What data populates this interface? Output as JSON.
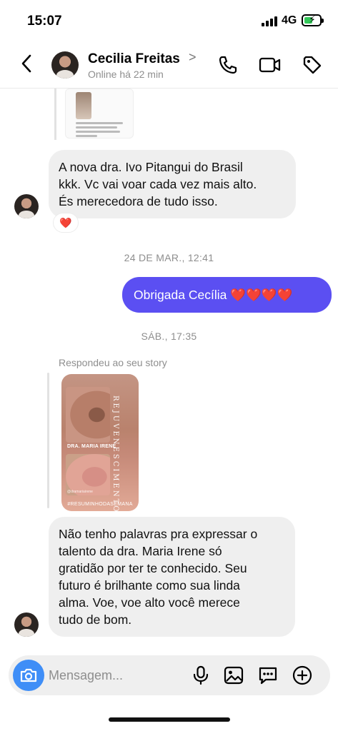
{
  "status_bar": {
    "time": "15:07",
    "network": "4G"
  },
  "header": {
    "contact_name": "Cecilia Freitas",
    "chevron": ">",
    "status": "Online há 22 min",
    "icons": [
      "back-arrow-icon",
      "phone-icon",
      "video-camera-icon",
      "tag-icon"
    ]
  },
  "messages": {
    "shared_post_preview": {
      "caption_lines": [
        "Vi se trabalho no TV Record, sou",
        "juntar, drmleto pra ir na sua",
        "máquina do tempo direto de Ames",
        "de Alpay R."
      ]
    },
    "msg1": {
      "lines": [
        "A nova dra. Ivo Pitangui do Brasil",
        "kkk. Vc  vai voar cada vez mais alto.",
        "És merecedora de tudo isso."
      ],
      "reaction": "❤️"
    },
    "separator1": "24 DE MAR., 12:41",
    "msg2": {
      "text": "Obrigada Cecília ❤️❤️❤️❤️"
    },
    "separator2": "SÁB., 17:35",
    "reply_label": "Respondeu ao seu story",
    "story": {
      "doctor_name": "DRA. MARIA IRENE",
      "vertical_word": "REJUVENESCIMENTO",
      "handle": "@dramariairene",
      "hashtag": "#RESUMINHODASEMANA"
    },
    "msg3": {
      "lines": [
        "Não tenho palavras pra expressar o",
        "talento da dra. Maria Irene só",
        "gratidão por ter te conhecido. Seu",
        "futuro é brilhante como sua linda",
        "alma. Voe, voe alto você merece",
        "tudo de bom."
      ]
    }
  },
  "composer": {
    "placeholder": "Mensagem...",
    "icons": [
      "camera-icon",
      "microphone-icon",
      "gallery-icon",
      "sticker-icon",
      "plus-icon"
    ]
  },
  "colors": {
    "outgoing_bubble": "#5b4ff2",
    "incoming_bubble": "#efefef",
    "camera_button": "#3f8ef7",
    "battery_fill": "#34c759"
  }
}
